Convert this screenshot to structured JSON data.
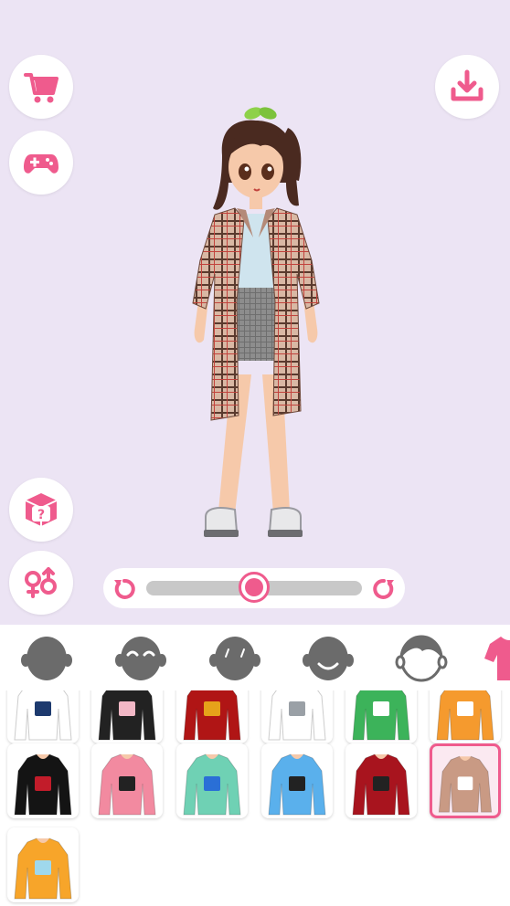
{
  "app": {
    "accent_color": "#ef5b8d",
    "stage_color": "#ece4f4"
  },
  "left_buttons": [
    {
      "name": "shop",
      "icon": "shopping-cart-icon"
    },
    {
      "name": "games",
      "icon": "gamepad-icon"
    },
    {
      "name": "random-outfit",
      "icon": "mystery-box-icon"
    },
    {
      "name": "gender-switch",
      "icon": "gender-icon"
    }
  ],
  "right_buttons": [
    {
      "name": "save",
      "icon": "download-icon"
    }
  ],
  "rotation_slider": {
    "value": 0.5
  },
  "categories": [
    {
      "name": "face-shape",
      "icon": "head-icon",
      "selected": false
    },
    {
      "name": "eyes",
      "icon": "head-closed-eyes-icon",
      "selected": false
    },
    {
      "name": "eyebrows",
      "icon": "head-brows-icon",
      "selected": false
    },
    {
      "name": "mouth",
      "icon": "head-smile-icon",
      "selected": false
    },
    {
      "name": "hair",
      "icon": "head-hair-outline-icon",
      "selected": false
    },
    {
      "name": "tops",
      "icon": "shirt-icon",
      "selected": true
    }
  ],
  "clothing_items": [
    {
      "colors": [
        "#ffffff",
        "#1d3a6e"
      ],
      "selected": false
    },
    {
      "colors": [
        "#222222",
        "#f2b8c6"
      ],
      "selected": false
    },
    {
      "colors": [
        "#b01515",
        "#e6a21a"
      ],
      "selected": false
    },
    {
      "colors": [
        "#ffffff",
        "#9aa0a6"
      ],
      "selected": false
    },
    {
      "colors": [
        "#3cb35a",
        "#ffffff"
      ],
      "selected": false
    },
    {
      "colors": [
        "#f59a2e",
        "#ffffff"
      ],
      "selected": false
    },
    {
      "colors": [
        "#141414",
        "#c21c2a"
      ],
      "selected": false
    },
    {
      "colors": [
        "#f28aa0",
        "#222222"
      ],
      "selected": false
    },
    {
      "colors": [
        "#6fd1b4",
        "#2a6fd6"
      ],
      "selected": false
    },
    {
      "colors": [
        "#5ab0ec",
        "#222222"
      ],
      "selected": false
    },
    {
      "colors": [
        "#a8141e",
        "#222222"
      ],
      "selected": false
    },
    {
      "colors": [
        "#c99a84",
        "#ffffff"
      ],
      "selected": true
    },
    {
      "colors": [
        "#f7a52a",
        "#9fd8ec"
      ],
      "selected": false
    }
  ]
}
